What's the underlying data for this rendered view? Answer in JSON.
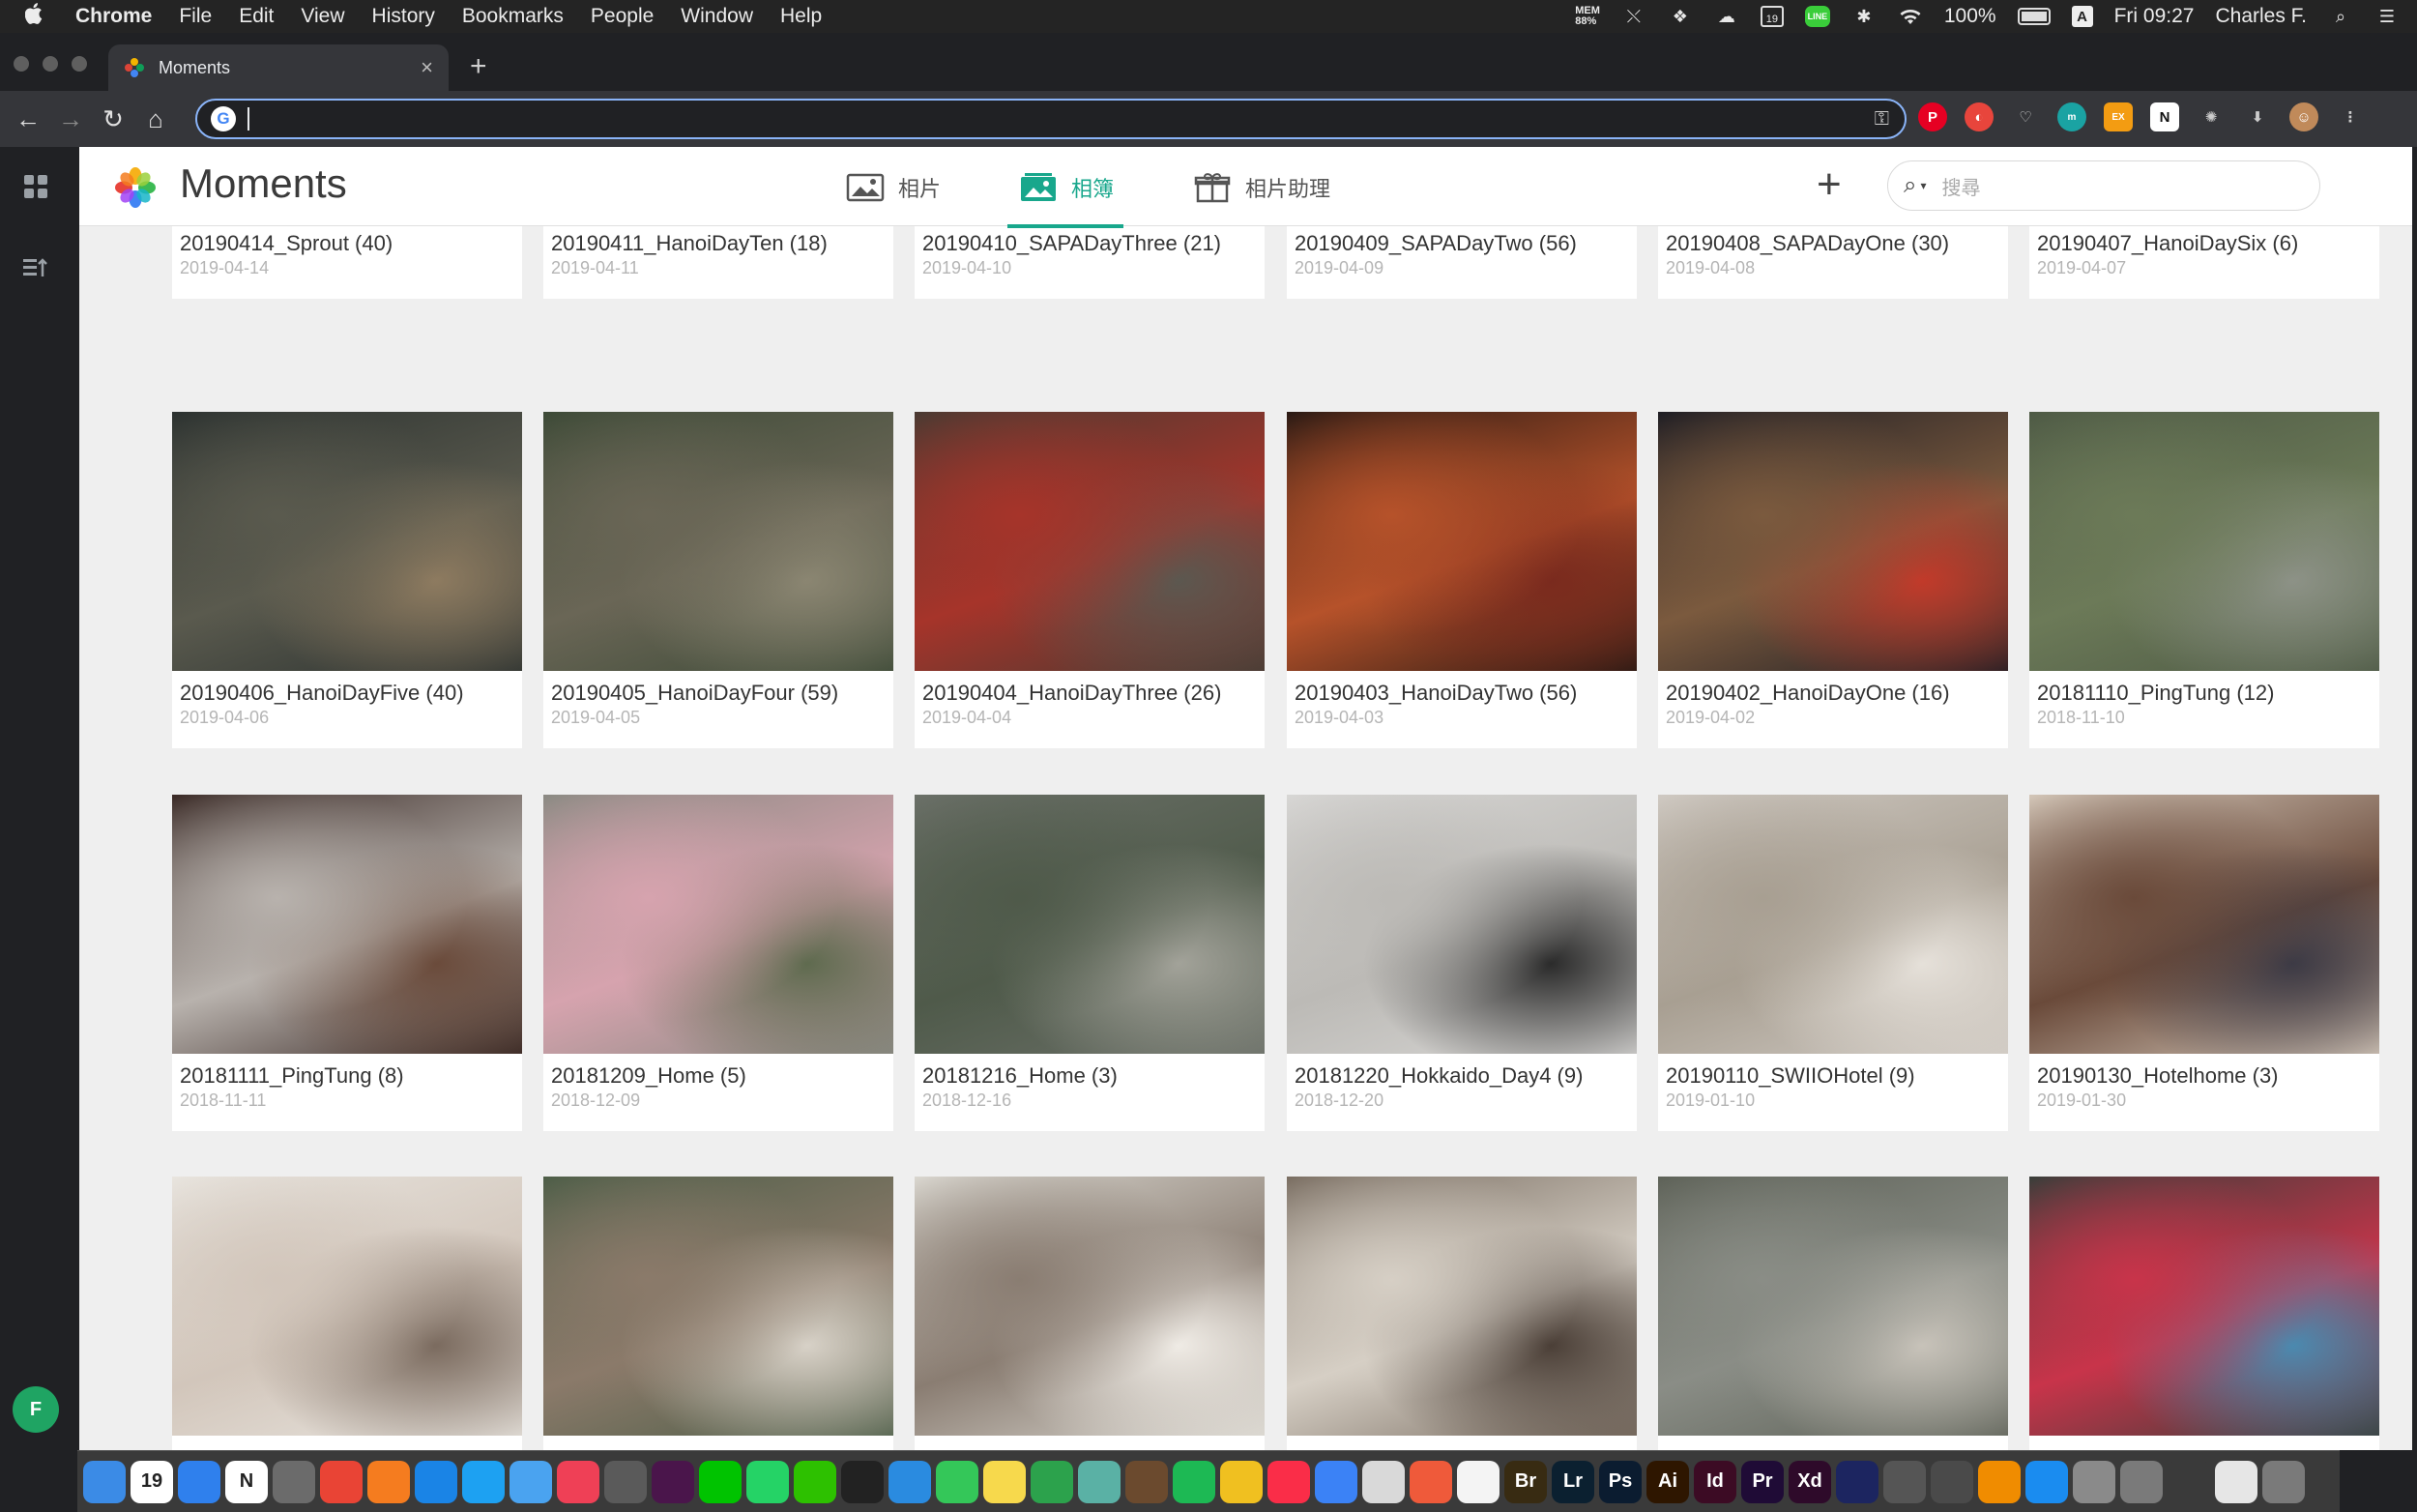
{
  "menubar": {
    "app": "Chrome",
    "items": [
      "File",
      "Edit",
      "View",
      "History",
      "Bookmarks",
      "People",
      "Window",
      "Help"
    ],
    "mem_top": "MEM",
    "mem_value": "88%",
    "calendar_day": "19",
    "line_label": "LINE",
    "battery": "100%",
    "input_source": "A",
    "clock": "Fri 09:27",
    "user": "Charles F."
  },
  "browser": {
    "tab_title": "Moments",
    "tab_close": "×",
    "new_tab": "+",
    "address": ""
  },
  "rail": {
    "avatar_initial": "F"
  },
  "app": {
    "brand": "Moments",
    "tabs": [
      {
        "label": "相片",
        "active": false
      },
      {
        "label": "相簿",
        "active": true
      },
      {
        "label": "相片助理",
        "active": false
      }
    ],
    "add_label": "+",
    "search_placeholder": "搜尋",
    "accent": "#18a78c"
  },
  "albums": [
    {
      "title": "20190414_Sprout (40)",
      "date": "2019-04-14",
      "colors": [
        "#3b2f25",
        "#9c6b3c",
        "#2f4a3a"
      ]
    },
    {
      "title": "20190411_HanoiDayTen (18)",
      "date": "2019-04-11",
      "colors": [
        "#2e3230",
        "#1e7d6c",
        "#5d4b3a"
      ]
    },
    {
      "title": "20190410_SAPADayThree (21)",
      "date": "2019-04-10",
      "colors": [
        "#2a4a3a",
        "#4b6f3e",
        "#1f2f2a"
      ]
    },
    {
      "title": "20190409_SAPADayTwo (56)",
      "date": "2019-04-09",
      "colors": [
        "#4a3d33",
        "#8a5a45",
        "#c23a6a"
      ]
    },
    {
      "title": "20190408_SAPADayOne (30)",
      "date": "2019-04-08",
      "colors": [
        "#3a3630",
        "#6e6152",
        "#23201c"
      ]
    },
    {
      "title": "20190407_HanoiDaySix (6)",
      "date": "2019-04-07",
      "colors": [
        "#b9bcc2",
        "#6e7d55",
        "#9a9da0"
      ]
    },
    {
      "title": "20190406_HanoiDayFive (40)",
      "date": "2019-04-06",
      "colors": [
        "#2c3230",
        "#5a5a4e",
        "#8e7b60"
      ]
    },
    {
      "title": "20190405_HanoiDayFour (59)",
      "date": "2019-04-05",
      "colors": [
        "#3d4a37",
        "#6a6656",
        "#8b8672"
      ]
    },
    {
      "title": "20190404_HanoiDayThree (26)",
      "date": "2019-04-04",
      "colors": [
        "#4a3a32",
        "#a6342a",
        "#5b5850"
      ]
    },
    {
      "title": "20190403_HanoiDayTwo (56)",
      "date": "2019-04-03",
      "colors": [
        "#2a1a14",
        "#b6522a",
        "#7a2a1e"
      ]
    },
    {
      "title": "20190402_HanoiDayOne (16)",
      "date": "2019-04-02",
      "colors": [
        "#1f1e24",
        "#7b5a3e",
        "#c23a2a"
      ]
    },
    {
      "title": "20181110_PingTung (12)",
      "date": "2018-11-10",
      "colors": [
        "#4e5a45",
        "#6c7a58",
        "#8d9287"
      ]
    },
    {
      "title": "20181111_PingTung (8)",
      "date": "2018-11-11",
      "colors": [
        "#3a2a26",
        "#b8b2ad",
        "#6a4a3a"
      ]
    },
    {
      "title": "20181209_Home (5)",
      "date": "2018-12-09",
      "colors": [
        "#8b8a83",
        "#d6a3ae",
        "#5e6a4e"
      ]
    },
    {
      "title": "20181216_Home (3)",
      "date": "2018-12-16",
      "colors": [
        "#6b7068",
        "#4f5a4a",
        "#a3a39a"
      ]
    },
    {
      "title": "20181220_Hokkaido_Day4 (9)",
      "date": "2018-12-20",
      "colors": [
        "#d7d6d4",
        "#bcbab6",
        "#2a2a2a"
      ]
    },
    {
      "title": "20190110_SWIIOHotel (9)",
      "date": "2019-01-10",
      "colors": [
        "#cfc9c2",
        "#a89f92",
        "#e6e1da"
      ]
    },
    {
      "title": "20190130_Hotelhome (3)",
      "date": "2019-01-30",
      "colors": [
        "#d3c6b8",
        "#6a4a3a",
        "#3c3a45"
      ]
    },
    {
      "title": "",
      "date": "",
      "colors": [
        "#e8e4de",
        "#d2c6bb",
        "#7a6a5e"
      ]
    },
    {
      "title": "",
      "date": "",
      "colors": [
        "#4e5e48",
        "#8b7a6a",
        "#d8d2c8"
      ]
    },
    {
      "title": "",
      "date": "",
      "colors": [
        "#d9d6cf",
        "#8a7d72",
        "#f0ece6"
      ]
    },
    {
      "title": "",
      "date": "",
      "colors": [
        "#7a6e62",
        "#d6cfc5",
        "#4a3e36"
      ]
    },
    {
      "title": "",
      "date": "",
      "colors": [
        "#5e6258",
        "#8a8d86",
        "#c8c3ba"
      ]
    },
    {
      "title": "",
      "date": "",
      "colors": [
        "#3a3e3a",
        "#c8344a",
        "#4a8ab0"
      ]
    }
  ],
  "dock": [
    {
      "icon": "finder-icon",
      "label": "",
      "bg": "#3b8be6"
    },
    {
      "icon": "calendar-icon",
      "label": "19",
      "bg": "#ffffff"
    },
    {
      "icon": "books-icon",
      "label": "",
      "bg": "#2f80ed"
    },
    {
      "icon": "notion-icon",
      "label": "N",
      "bg": "#ffffff"
    },
    {
      "icon": "eagle-icon",
      "label": "",
      "bg": "#6b6b6b"
    },
    {
      "icon": "chrome-icon",
      "label": "",
      "bg": "#e94435"
    },
    {
      "icon": "firefox-icon",
      "label": "",
      "bg": "#f57c1f"
    },
    {
      "icon": "safari-icon",
      "label": "",
      "bg": "#1a84e6"
    },
    {
      "icon": "twitter-icon",
      "label": "",
      "bg": "#1da1f2"
    },
    {
      "icon": "mail-icon",
      "label": "",
      "bg": "#4aa3f0"
    },
    {
      "icon": "pocket-icon",
      "label": "",
      "bg": "#ef4056"
    },
    {
      "icon": "shield-icon",
      "label": "",
      "bg": "#5a5a5a"
    },
    {
      "icon": "slack-icon",
      "label": "",
      "bg": "#4a154b"
    },
    {
      "icon": "line-icon",
      "label": "",
      "bg": "#00c300"
    },
    {
      "icon": "whatsapp-icon",
      "label": "",
      "bg": "#25d366"
    },
    {
      "icon": "wechat-icon",
      "label": "",
      "bg": "#2dc100"
    },
    {
      "icon": "qq-icon",
      "label": "",
      "bg": "#222222"
    },
    {
      "icon": "tweetbot-icon",
      "label": "",
      "bg": "#2a8be0"
    },
    {
      "icon": "messages-icon",
      "label": "",
      "bg": "#34c759"
    },
    {
      "icon": "notes-icon",
      "label": "",
      "bg": "#f7d94c"
    },
    {
      "icon": "numbers-icon",
      "label": "",
      "bg": "#2ca24c"
    },
    {
      "icon": "owl-icon",
      "label": "",
      "bg": "#5ab1a5"
    },
    {
      "icon": "archive-icon",
      "label": "",
      "bg": "#6b4a2e"
    },
    {
      "icon": "spotify-icon",
      "label": "",
      "bg": "#1db954"
    },
    {
      "icon": "maps-icon",
      "label": "",
      "bg": "#f0c020"
    },
    {
      "icon": "music-icon",
      "label": "",
      "bg": "#fa2d48"
    },
    {
      "icon": "keynote-icon",
      "label": "",
      "bg": "#3b82f6"
    },
    {
      "icon": "preview-icon",
      "label": "",
      "bg": "#d9d9d9"
    },
    {
      "icon": "istat-icon",
      "label": "",
      "bg": "#ef5a3a"
    },
    {
      "icon": "photos-icon",
      "label": "",
      "bg": "#f4f4f4"
    },
    {
      "icon": "bridge-icon",
      "label": "Br",
      "bg": "#382b12"
    },
    {
      "icon": "lightroom-icon",
      "label": "Lr",
      "bg": "#0b2030"
    },
    {
      "icon": "photoshop-icon",
      "label": "Ps",
      "bg": "#0b1c30"
    },
    {
      "icon": "illustrator-icon",
      "label": "Ai",
      "bg": "#2e1600"
    },
    {
      "icon": "indesign-icon",
      "label": "Id",
      "bg": "#3c0b24"
    },
    {
      "icon": "premiere-icon",
      "label": "Pr",
      "bg": "#1f0b36"
    },
    {
      "icon": "xd-icon",
      "label": "Xd",
      "bg": "#2e0a2a"
    },
    {
      "icon": "sketch-icon",
      "label": "",
      "bg": "#1c2560"
    },
    {
      "icon": "dark-icon",
      "label": "",
      "bg": "#555555"
    },
    {
      "icon": "drive-icon",
      "label": "",
      "bg": "#4a4a4a"
    },
    {
      "icon": "vlc-icon",
      "label": "",
      "bg": "#f08c00"
    },
    {
      "icon": "appstore-icon",
      "label": "",
      "bg": "#1a8cf0"
    },
    {
      "icon": "launchpad-icon",
      "label": "",
      "bg": "#8a8a8a"
    },
    {
      "icon": "settings-icon",
      "label": "",
      "bg": "#7a7a7a"
    },
    {
      "icon": "iphone-icon",
      "label": "",
      "bg": "#3a3a3a"
    },
    {
      "icon": "downloads-icon",
      "label": "",
      "bg": "#e6e6e6"
    },
    {
      "icon": "trash-icon",
      "label": "",
      "bg": "#7a7a7a"
    }
  ]
}
